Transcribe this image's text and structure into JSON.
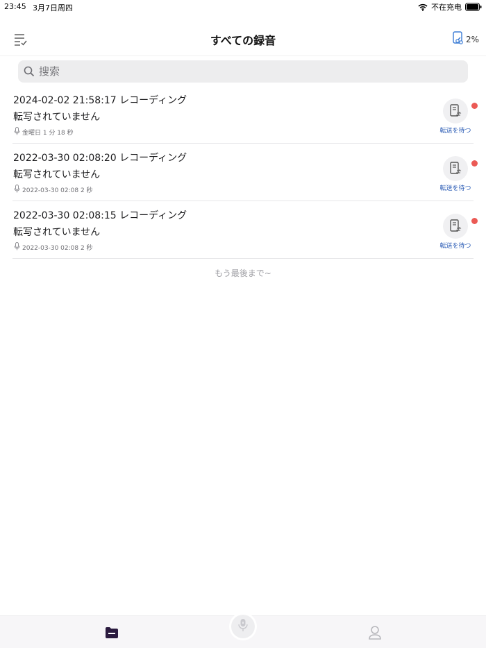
{
  "status_bar": {
    "time": "23:45",
    "date": "3月7日周四",
    "charging_text": "不在充电"
  },
  "nav": {
    "title": "すべての録音",
    "storage_pct": "2%"
  },
  "search": {
    "placeholder": "搜索"
  },
  "recordings": [
    {
      "title": "2024-02-02 21:58:17 レコーディング",
      "status": "転写されていません",
      "meta": "金曜日  1 分 18 秒",
      "action_label": "転送を待つ"
    },
    {
      "title": "2022-03-30 02:08:20 レコーディング",
      "status": "転写されていません",
      "meta": "2022-03-30 02:08  2 秒",
      "action_label": "転送を待つ"
    },
    {
      "title": "2022-03-30 02:08:15 レコーディング",
      "status": "転写されていません",
      "meta": "2022-03-30 02:08  2 秒",
      "action_label": "転送を待つ"
    }
  ],
  "list_end_text": "もう最後まで~",
  "colors": {
    "accent_link": "#2a5bb5",
    "unread_dot": "#eb5a55",
    "tab_active": "#2b1b3f"
  }
}
